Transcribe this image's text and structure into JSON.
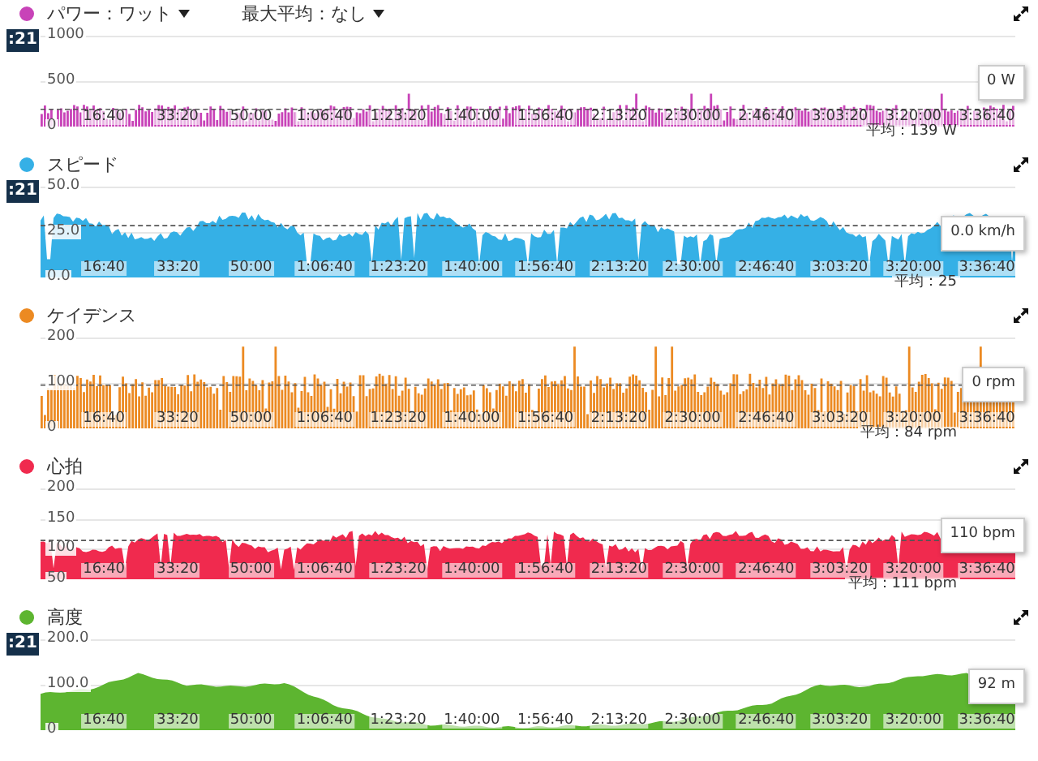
{
  "panels": [
    {
      "kind": "bars",
      "color": "#c843b8",
      "dropdowns": [
        "パワー：ワット",
        "最大平均：なし"
      ],
      "time_badge": ":21",
      "y_labels": [
        "1000",
        "500",
        "0"
      ],
      "x_labels": [
        "16:40",
        "33:20",
        "50:00",
        "1:06:40",
        "1:23:20",
        "1:40:00",
        "1:56:40",
        "2:13:20",
        "2:30:00",
        "2:46:40",
        "3:03:20",
        "3:20:00",
        "3:36:40"
      ],
      "reading": "0 W",
      "average": "平均：139 W"
    },
    {
      "kind": "area",
      "color": "#35b0e6",
      "title": "スピード",
      "time_badge": ":21",
      "y_labels": [
        "50.0",
        "25.0",
        "0.0"
      ],
      "x_labels": [
        "16:40",
        "33:20",
        "50:00",
        "1:06:40",
        "1:23:20",
        "1:40:00",
        "1:56:40",
        "2:13:20",
        "2:30:00",
        "2:46:40",
        "3:03:20",
        "3:20:00",
        "3:36:40"
      ],
      "reading": "0.0 km/h",
      "average": "平均：25"
    },
    {
      "kind": "bars",
      "color": "#ec8a22",
      "title": "ケイデンス",
      "y_labels": [
        "200",
        "100",
        "0"
      ],
      "x_labels": [
        "16:40",
        "33:20",
        "50:00",
        "1:06:40",
        "1:23:20",
        "1:40:00",
        "1:56:40",
        "2:13:20",
        "2:30:00",
        "2:46:40",
        "3:03:20",
        "3:20:00",
        "3:36:40"
      ],
      "reading": "0 rpm",
      "average": "平均：84 rpm"
    },
    {
      "kind": "area",
      "color": "#f02a4e",
      "title": "心拍",
      "y_labels": [
        "200",
        "150",
        "100",
        "50"
      ],
      "x_labels": [
        "16:40",
        "33:20",
        "50:00",
        "1:06:40",
        "1:23:20",
        "1:40:00",
        "1:56:40",
        "2:13:20",
        "2:30:00",
        "2:46:40",
        "3:03:20",
        "3:20:00",
        "3:36:40"
      ],
      "reading": "110 bpm",
      "average": "平均：111 bpm"
    },
    {
      "kind": "profile",
      "color": "#5db530",
      "title": "高度",
      "time_badge": ":21",
      "y_labels": [
        "200.0",
        "100.0",
        "0"
      ],
      "x_labels": [
        "16:40",
        "33:20",
        "50:00",
        "1:06:40",
        "1:23:20",
        "1:40:00",
        "1:56:40",
        "2:13:20",
        "2:30:00",
        "2:46:40",
        "3:03:20",
        "3:20:00",
        "3:36:40"
      ],
      "reading": "92 m"
    }
  ]
}
